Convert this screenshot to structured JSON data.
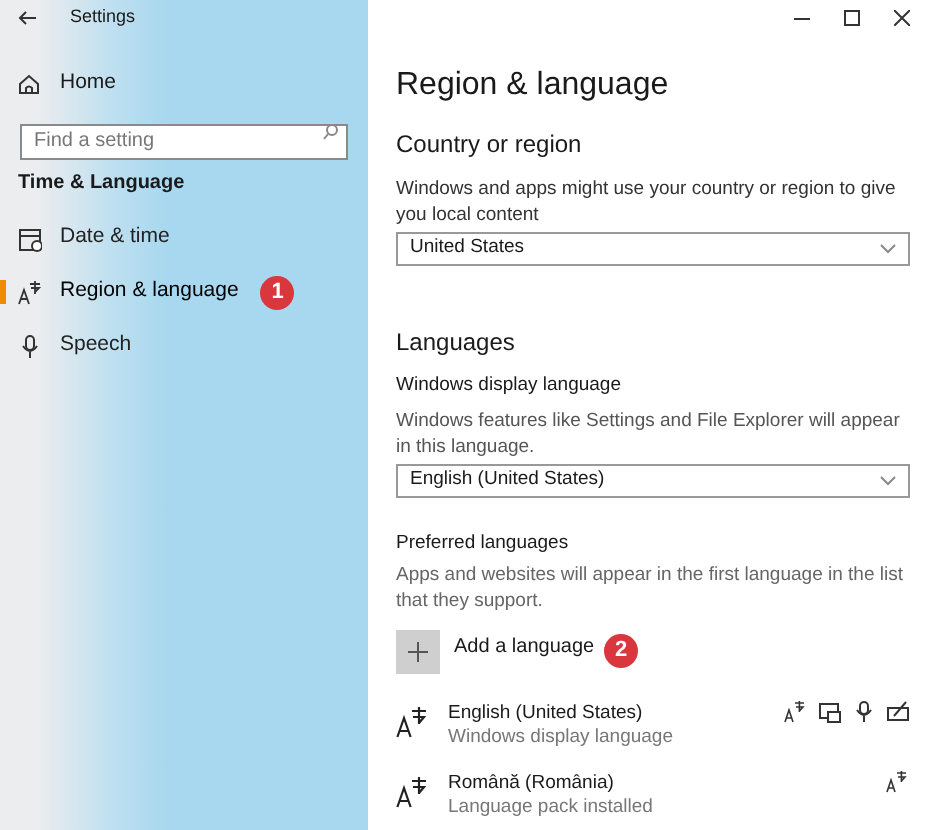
{
  "window": {
    "title": "Settings"
  },
  "sidebar": {
    "home": "Home",
    "search": {
      "placeholder": "Find a setting"
    },
    "section": "Time & Language",
    "items": [
      {
        "label": "Date & time",
        "kind": "calendar",
        "selected": false
      },
      {
        "label": "Region & language",
        "kind": "language",
        "selected": true,
        "badge": "1"
      },
      {
        "label": "Speech",
        "kind": "microphone",
        "selected": false
      }
    ]
  },
  "page": {
    "title": "Region & language",
    "country": {
      "heading": "Country or region",
      "description": "Windows and apps might use your country or region to give you local content",
      "value": "United States"
    },
    "languages": {
      "heading": "Languages",
      "display_label": "Windows display language",
      "display_description": "Windows features like Settings and File Explorer will appear in this language.",
      "display_value": "English (United States)",
      "preferred_label": "Preferred languages",
      "preferred_description": "Apps and websites will appear in the first language in the list that they support.",
      "add_button": {
        "label": "Add a language",
        "badge": "2"
      },
      "list": [
        {
          "name": "English (United States)",
          "status": "Windows display language",
          "features": [
            {
              "kind": "language"
            },
            {
              "kind": "display"
            },
            {
              "kind": "speech"
            },
            {
              "kind": "handwriting"
            }
          ]
        },
        {
          "name": "Română (România)",
          "status": "Language pack installed",
          "features": [
            {
              "kind": "language"
            }
          ]
        }
      ]
    }
  }
}
